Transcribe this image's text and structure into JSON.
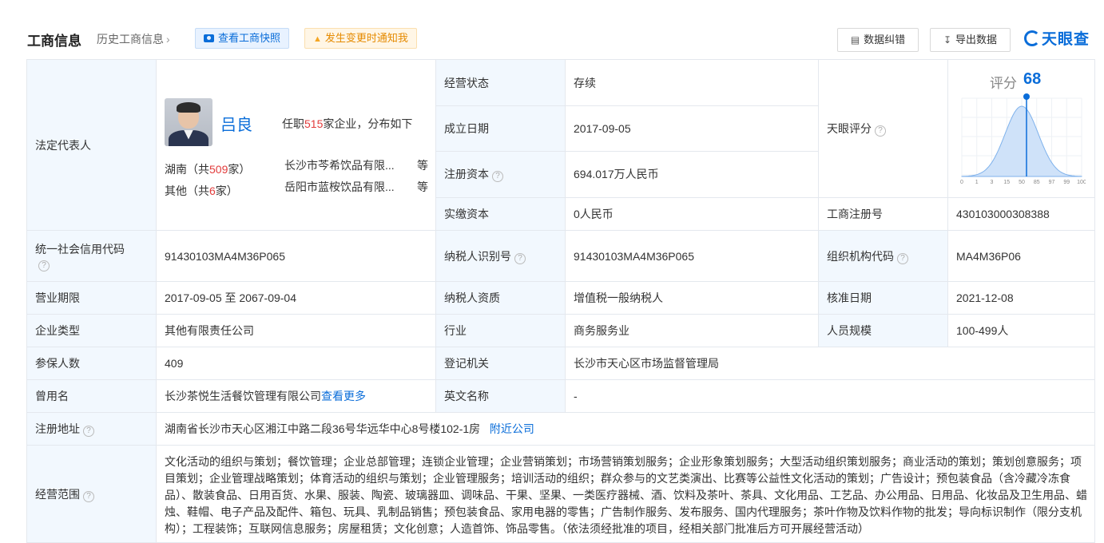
{
  "header": {
    "title": "工商信息",
    "history_link": "历史工商信息",
    "snapshot_button": "查看工商快照",
    "notify_button": "发生变更时通知我",
    "correct_button": "数据纠错",
    "export_button": "导出数据",
    "logo_text": "天眼查"
  },
  "legal_rep": {
    "label": "法定代表人",
    "name": "吕良",
    "info_prefix": "任职",
    "info_count": "515",
    "info_suffix": "家企业，分布如下",
    "regions": [
      {
        "prefix": "湖南（共",
        "count": "509",
        "suffix": "家）",
        "company": "长沙市芩希饮品有限...",
        "etc": "等"
      },
      {
        "prefix": "其他（共",
        "count": "6",
        "suffix": "家）",
        "company": "岳阳市蓝桉饮品有限...",
        "etc": "等"
      }
    ]
  },
  "fields": {
    "status": {
      "label": "经营状态",
      "value": "存续"
    },
    "established": {
      "label": "成立日期",
      "value": "2017-09-05"
    },
    "reg_capital": {
      "label": "注册资本",
      "value": "694.017万人民币"
    },
    "paid_capital": {
      "label": "实缴资本",
      "value": "0人民币"
    },
    "tianyan_score": {
      "label": "天眼评分"
    },
    "reg_no": {
      "label": "工商注册号",
      "value": "430103000308388"
    },
    "credit_code": {
      "label": "统一社会信用代码",
      "value": "91430103MA4M36P065"
    },
    "taxpayer_id": {
      "label": "纳税人识别号",
      "value": "91430103MA4M36P065"
    },
    "org_code": {
      "label": "组织机构代码",
      "value": "MA4M36P06"
    },
    "term": {
      "label": "营业期限",
      "value": "2017-09-05 至 2067-09-04"
    },
    "taxpayer_qual": {
      "label": "纳税人资质",
      "value": "增值税一般纳税人"
    },
    "approval_date": {
      "label": "核准日期",
      "value": "2021-12-08"
    },
    "company_type": {
      "label": "企业类型",
      "value": "其他有限责任公司"
    },
    "industry": {
      "label": "行业",
      "value": "商务服务业"
    },
    "staff_size": {
      "label": "人员规模",
      "value": "100-499人"
    },
    "insured": {
      "label": "参保人数",
      "value": "409"
    },
    "authority": {
      "label": "登记机关",
      "value": "长沙市天心区市场监督管理局"
    },
    "former_name": {
      "label": "曾用名",
      "value": "长沙茶悦生活餐饮管理有限公司",
      "more": "查看更多"
    },
    "english_name": {
      "label": "英文名称",
      "value": "-"
    },
    "address": {
      "label": "注册地址",
      "value": "湖南省长沙市天心区湘江中路二段36号华远华中心8号楼102-1房",
      "nearby": "附近公司"
    },
    "scope": {
      "label": "经营范围",
      "value": "文化活动的组织与策划；餐饮管理；企业总部管理；连锁企业管理；企业营销策划；市场营销策划服务；企业形象策划服务；大型活动组织策划服务；商业活动的策划；策划创意服务；项目策划；企业管理战略策划；体育活动的组织与策划；企业管理服务；培训活动的组织；群众参与的文艺类演出、比赛等公益性文化活动的策划；广告设计；预包装食品（含冷藏冷冻食品）、散装食品、日用百货、水果、服装、陶瓷、玻璃器皿、调味品、干果、坚果、一类医疗器械、酒、饮料及茶叶、茶具、文化用品、工艺品、办公用品、日用品、化妆品及卫生用品、蜡烛、鞋帽、电子产品及配件、箱包、玩具、乳制品销售；预包装食品、家用电器的零售；广告制作服务、发布服务、国内代理服务；茶叶作物及饮料作物的批发；导向标识制作（限分支机构）；工程装饰；互联网信息服务；房屋租赁；文化创意；人造首饰、饰品零售。（依法须经批准的项目，经相关部门批准后方可开展经营活动）"
    }
  },
  "score": {
    "label": "评分",
    "value": 68,
    "ticks": [
      "0",
      "1",
      "3",
      "15",
      "50",
      "85",
      "97",
      "99",
      "100"
    ],
    "accent": "#0a6dd9"
  }
}
